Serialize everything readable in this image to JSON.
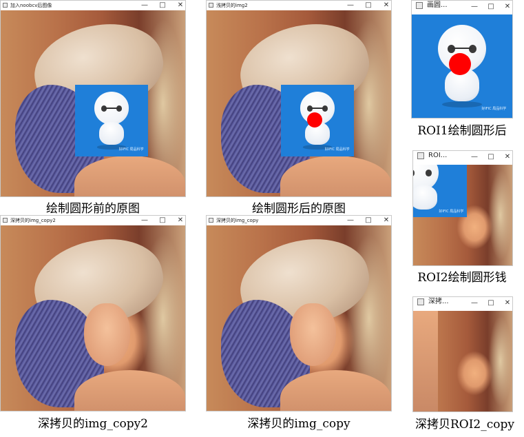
{
  "windows": {
    "w1": {
      "title": "加入noobcv后图像",
      "caption": "绘制圆形前的原图"
    },
    "w2": {
      "title": "浅拷贝的img2",
      "caption": "绘制圆形后的原图"
    },
    "w3": {
      "title": "深拷贝的img_copy2",
      "caption": "深拷贝的img_copy2"
    },
    "w4": {
      "title": "深拷贝的img_copy",
      "caption": "深拷贝的img_copy"
    },
    "w5": {
      "title": "画圆...",
      "caption": "ROI1绘制圆形后"
    },
    "w6": {
      "title": "ROI...",
      "caption": "ROI2绘制圆形钱"
    },
    "w7": {
      "title": "深拷...",
      "caption": "深拷贝ROI2_copy"
    }
  },
  "controls": {
    "minimize": "—",
    "maximize": "□",
    "close": "✕"
  },
  "overlay": {
    "watermark": "好IFIC 局品科学",
    "accent": "#1f7fd9",
    "dot": "#ff0000"
  }
}
